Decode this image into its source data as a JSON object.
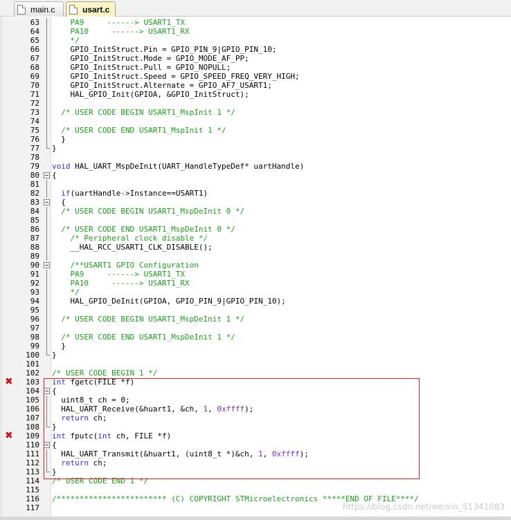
{
  "tabs": [
    {
      "label": "main.c",
      "active": false
    },
    {
      "label": "usart.c",
      "active": true
    }
  ],
  "breakpoint_glyph": "✖",
  "lines": [
    {
      "n": "63",
      "tokens": [
        [
          "comment",
          "    PA9     ------> USART1_TX"
        ]
      ]
    },
    {
      "n": "64",
      "tokens": [
        [
          "comment",
          "    PA10     ------> USART1_RX"
        ]
      ]
    },
    {
      "n": "65",
      "tokens": [
        [
          "comment",
          "    */"
        ]
      ]
    },
    {
      "n": "66",
      "tokens": [
        [
          "text",
          "    GPIO_InitStruct.Pin = GPIO_PIN_9|GPIO_PIN_10;"
        ]
      ]
    },
    {
      "n": "67",
      "tokens": [
        [
          "text",
          "    GPIO_InitStruct.Mode = GPIO_MODE_AF_PP;"
        ]
      ]
    },
    {
      "n": "68",
      "tokens": [
        [
          "text",
          "    GPIO_InitStruct.Pull = GPIO_NOPULL;"
        ]
      ]
    },
    {
      "n": "69",
      "tokens": [
        [
          "text",
          "    GPIO_InitStruct.Speed = GPIO_SPEED_FREQ_VERY_HIGH;"
        ]
      ]
    },
    {
      "n": "70",
      "tokens": [
        [
          "text",
          "    GPIO_InitStruct.Alternate = GPIO_AF7_USART1;"
        ]
      ]
    },
    {
      "n": "71",
      "tokens": [
        [
          "text",
          "    HAL_GPIO_Init(GPIOA, &GPIO_InitStruct);"
        ]
      ]
    },
    {
      "n": "72",
      "tokens": []
    },
    {
      "n": "73",
      "tokens": [
        [
          "comment",
          "  /* USER CODE BEGIN USART1_MspInit 1 */"
        ]
      ]
    },
    {
      "n": "74",
      "tokens": []
    },
    {
      "n": "75",
      "tokens": [
        [
          "comment",
          "  /* USER CODE END USART1_MspInit 1 */"
        ]
      ]
    },
    {
      "n": "76",
      "tokens": [
        [
          "text",
          "  }"
        ]
      ]
    },
    {
      "n": "77",
      "tokens": [
        [
          "text",
          "}"
        ]
      ]
    },
    {
      "n": "78",
      "tokens": []
    },
    {
      "n": "79",
      "tokens": [
        [
          "kw",
          "void"
        ],
        [
          "text",
          " HAL_UART_MspDeInit(UART_HandleTypeDef* uartHandle)"
        ]
      ]
    },
    {
      "n": "80",
      "tokens": [
        [
          "text",
          "{"
        ]
      ]
    },
    {
      "n": "81",
      "tokens": []
    },
    {
      "n": "82",
      "tokens": [
        [
          "text",
          "  "
        ],
        [
          "kw",
          "if"
        ],
        [
          "text",
          "(uartHandle->Instance==USART1)"
        ]
      ]
    },
    {
      "n": "83",
      "tokens": [
        [
          "text",
          "  {"
        ]
      ]
    },
    {
      "n": "84",
      "tokens": [
        [
          "comment",
          "  /* USER CODE BEGIN USART1_MspDeInit 0 */"
        ]
      ]
    },
    {
      "n": "85",
      "tokens": []
    },
    {
      "n": "86",
      "tokens": [
        [
          "comment",
          "  /* USER CODE END USART1_MspDeInit 0 */"
        ]
      ]
    },
    {
      "n": "87",
      "tokens": [
        [
          "comment",
          "    /* Peripheral clock disable */"
        ]
      ]
    },
    {
      "n": "88",
      "tokens": [
        [
          "text",
          "    __HAL_RCC_USART1_CLK_DISABLE();"
        ]
      ]
    },
    {
      "n": "89",
      "tokens": []
    },
    {
      "n": "90",
      "tokens": [
        [
          "comment",
          "    /**USART1 GPIO Configuration"
        ]
      ]
    },
    {
      "n": "91",
      "tokens": [
        [
          "comment",
          "    PA9     ------> USART1_TX"
        ]
      ]
    },
    {
      "n": "92",
      "tokens": [
        [
          "comment",
          "    PA10     ------> USART1_RX"
        ]
      ]
    },
    {
      "n": "93",
      "tokens": [
        [
          "comment",
          "    */"
        ]
      ]
    },
    {
      "n": "94",
      "tokens": [
        [
          "text",
          "    HAL_GPIO_DeInit(GPIOA, GPIO_PIN_9|GPIO_PIN_10);"
        ]
      ]
    },
    {
      "n": "95",
      "tokens": []
    },
    {
      "n": "96",
      "tokens": [
        [
          "comment",
          "  /* USER CODE BEGIN USART1_MspDeInit 1 */"
        ]
      ]
    },
    {
      "n": "97",
      "tokens": []
    },
    {
      "n": "98",
      "tokens": [
        [
          "comment",
          "  /* USER CODE END USART1_MspDeInit 1 */"
        ]
      ]
    },
    {
      "n": "99",
      "tokens": [
        [
          "text",
          "  }"
        ]
      ]
    },
    {
      "n": "100",
      "tokens": [
        [
          "text",
          "}"
        ]
      ]
    },
    {
      "n": "101",
      "tokens": []
    },
    {
      "n": "102",
      "tokens": [
        [
          "comment",
          "/* USER CODE BEGIN 1 */"
        ]
      ]
    },
    {
      "n": "103",
      "tokens": [
        [
          "kw",
          "int"
        ],
        [
          "text",
          " fgetc(FILE *f)"
        ]
      ]
    },
    {
      "n": "104",
      "tokens": [
        [
          "text",
          "{"
        ]
      ]
    },
    {
      "n": "105",
      "tokens": [
        [
          "text",
          "  uint8_t ch = 0;"
        ]
      ]
    },
    {
      "n": "106",
      "tokens": [
        [
          "text",
          "  HAL_UART_Receive(&huart1, &ch, "
        ],
        [
          "num",
          "1"
        ],
        [
          "text",
          ", "
        ],
        [
          "num",
          "0xffff"
        ],
        [
          "text",
          ");"
        ]
      ]
    },
    {
      "n": "107",
      "tokens": [
        [
          "text",
          "  "
        ],
        [
          "kw",
          "return"
        ],
        [
          "text",
          " ch;"
        ]
      ]
    },
    {
      "n": "108",
      "tokens": [
        [
          "text",
          "}"
        ]
      ]
    },
    {
      "n": "109",
      "tokens": [
        [
          "kw",
          "int"
        ],
        [
          "text",
          " fputc("
        ],
        [
          "kw",
          "int"
        ],
        [
          "text",
          " ch, FILE *f)"
        ]
      ]
    },
    {
      "n": "110",
      "tokens": [
        [
          "text",
          "{"
        ]
      ]
    },
    {
      "n": "111",
      "tokens": [
        [
          "text",
          "  HAL_UART_Transmit(&huart1, (uint8_t *)&ch, "
        ],
        [
          "num",
          "1"
        ],
        [
          "text",
          ", "
        ],
        [
          "num",
          "0xffff"
        ],
        [
          "text",
          ");"
        ]
      ]
    },
    {
      "n": "112",
      "tokens": [
        [
          "text",
          "  "
        ],
        [
          "kw",
          "return"
        ],
        [
          "text",
          " ch;"
        ]
      ]
    },
    {
      "n": "113",
      "tokens": [
        [
          "text",
          "}"
        ]
      ]
    },
    {
      "n": "114",
      "tokens": [
        [
          "comment",
          "/* USER CODE END 1 */"
        ]
      ]
    },
    {
      "n": "115",
      "tokens": []
    },
    {
      "n": "116",
      "tokens": [
        [
          "comment",
          "/************************ (C) COPYRIGHT STMicroelectronics *****END OF FILE****/"
        ]
      ]
    },
    {
      "n": "117",
      "tokens": []
    }
  ],
  "fold_open": [
    "80",
    "83",
    "90",
    "104",
    "110"
  ],
  "fold_close": [
    "77",
    "100",
    "108",
    "113"
  ],
  "fold_inner": [
    "63",
    "64",
    "65",
    "66",
    "67",
    "68",
    "69",
    "70",
    "71",
    "72",
    "73",
    "74",
    "75",
    "76",
    "81",
    "82",
    "84",
    "85",
    "86",
    "87",
    "88",
    "89",
    "91",
    "92",
    "93",
    "94",
    "95",
    "96",
    "97",
    "98",
    "99",
    "105",
    "106",
    "107",
    "111",
    "112"
  ],
  "breakpoints": [
    "103",
    "109"
  ],
  "watermark": "https://blog.csdn.net/weixin_51341083"
}
